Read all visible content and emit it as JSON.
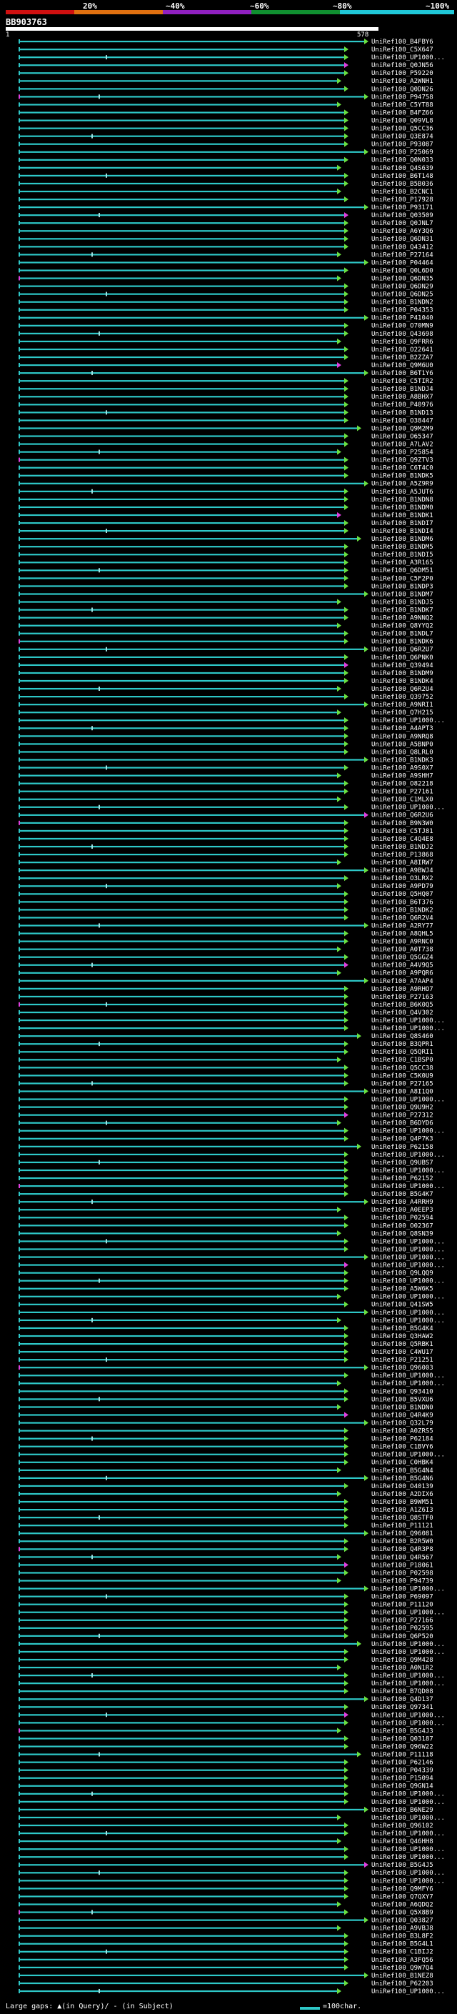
{
  "scale": {
    "labels": [
      "20%",
      "~40%",
      "~60%",
      "~80%",
      "~100%"
    ],
    "colors": [
      "#d01010",
      "#e07010",
      "#9020c0",
      "#109030",
      "#20c8d8"
    ]
  },
  "query": {
    "id": "BB903763",
    "start": "1",
    "end": "578"
  },
  "legend": {
    "text": "Large gaps: ▲(in Query)/ - (in Subject)",
    "scale_text": "=100char."
  },
  "colors": {
    "hit": "#2ec8c8",
    "arrow": "#6ae040",
    "magenta": "#e040e0",
    "gap": "#a0e0e0"
  },
  "hits": [
    "UniRef100_B4FBY6",
    "UniRef100_C5X647",
    "UniRef100_UP1000...",
    "UniRef100_Q0JN56",
    "UniRef100_P59220",
    "UniRef100_A2WNH1",
    "UniRef100_Q0DN26",
    "UniRef100_P94758",
    "UniRef100_C5YT88",
    "UniRef100_B4FZ66",
    "UniRef100_Q09VL8",
    "UniRef100_Q5CC36",
    "UniRef100_Q3E874",
    "UniRef100_P93087",
    "UniRef100_P25069",
    "UniRef100_Q0N033",
    "UniRef100_Q4S639",
    "UniRef100_B6T148",
    "UniRef100_B5B036",
    "UniRef100_B2CNC1",
    "UniRef100_P17928",
    "UniRef100_P93171",
    "UniRef100_Q03509",
    "UniRef100_Q0JNL7",
    "UniRef100_A6Y3Q6",
    "UniRef100_Q6DN31",
    "UniRef100_Q43412",
    "UniRef100_P27164",
    "UniRef100_P04464",
    "UniRef100_Q0L6D0",
    "UniRef100_Q6DN35",
    "UniRef100_Q6DN29",
    "UniRef100_Q6DN25",
    "UniRef100_B1NDN2",
    "UniRef100_P04353",
    "UniRef100_P41040",
    "UniRef100_O70MN9",
    "UniRef100_Q43698",
    "UniRef100_Q9FRR6",
    "UniRef100_O22641",
    "UniRef100_B2ZZA7",
    "UniRef100_Q9M6U0",
    "UniRef100_B6T1Y6",
    "UniRef100_C5TIR2",
    "UniRef100_B1NDJ4",
    "UniRef100_A8BHX7",
    "UniRef100_P40976",
    "UniRef100_B1ND13",
    "UniRef100_O38447",
    "UniRef100_Q9M2M9",
    "UniRef100_O65347",
    "UniRef100_A7LAV2",
    "UniRef100_P25854",
    "UniRef100_Q9ZTV3",
    "UniRef100_C6T4C0",
    "UniRef100_B1NDK5",
    "UniRef100_A5Z9R9",
    "UniRef100_A5JUT6",
    "UniRef100_B1NDN8",
    "UniRef100_B1NDM0",
    "UniRef100_B1NDK1",
    "UniRef100_B1NDI7",
    "UniRef100_B1NDI4",
    "UniRef100_B1NDM6",
    "UniRef100_B1NDM5",
    "UniRef100_B1NDI5",
    "UniRef100_A3R165",
    "UniRef100_Q6DM51",
    "UniRef100_C5F2P0",
    "UniRef100_B1NDP3",
    "UniRef100_B1NDM7",
    "UniRef100_B1NDJ5",
    "UniRef100_B1NDK7",
    "UniRef100_A9NNQ2",
    "UniRef100_Q8YYQ2",
    "UniRef100_B1NDL7",
    "UniRef100_B1NDK6",
    "UniRef100_Q6R2U7",
    "UniRef100_Q6PNK0",
    "UniRef100_Q39494",
    "UniRef100_B1NDM9",
    "UniRef100_B1NDK4",
    "UniRef100_Q6R2U4",
    "UniRef100_Q39752",
    "UniRef100_A9NRI1",
    "UniRef100_Q7H215",
    "UniRef100_UP1000...",
    "UniRef100_A4APT3",
    "UniRef100_A9NRQ8",
    "UniRef100_A5BNP0",
    "UniRef100_Q8LRL0",
    "UniRef100_B1NDK3",
    "UniRef100_A9S0X7",
    "UniRef100_A9SHH7",
    "UniRef100_O82218",
    "UniRef100_P27161",
    "UniRef100_C1MLX0",
    "UniRef100_UP1000...",
    "UniRef100_Q6R2U6",
    "UniRef100_B9N3W0",
    "UniRef100_C5TJ81",
    "UniRef100_C4Q4E8",
    "UniRef100_B1NDJ2",
    "UniRef100_P13868",
    "UniRef100_A8IRW7",
    "UniRef100_A9BWJ4",
    "UniRef100_O3LRX2",
    "UniRef100_A9PD79",
    "UniRef100_Q5HQ07",
    "UniRef100_B6T376",
    "UniRef100_B1NDK2",
    "UniRef100_Q6R2V4",
    "UniRef100_A2RY77",
    "UniRef100_A8QHL5",
    "UniRef100_A9RNC0",
    "UniRef100_A0T738",
    "UniRef100_Q5GGZ4",
    "UniRef100_A4V9Q5",
    "UniRef100_A9PQR6",
    "UniRef100_A7AAP4",
    "UniRef100_A9RHO7",
    "UniRef100_P27163",
    "UniRef100_B6K0Q5",
    "UniRef100_Q4V302",
    "UniRef100_UP1000...",
    "UniRef100_UP1000...",
    "UniRef100_Q8S460",
    "UniRef100_B3QPR1",
    "UniRef100_Q5QRI1",
    "UniRef100_C1BSP0",
    "UniRef100_Q5CC38",
    "UniRef100_C5K0U9",
    "UniRef100_P27165",
    "UniRef100_A8I1Q0",
    "UniRef100_UP1000...",
    "UniRef100_Q9U9H2",
    "UniRef100_P27312",
    "UniRef100_B6DYD6",
    "UniRef100_UP1000...",
    "UniRef100_Q4P7K3",
    "UniRef100_P62158",
    "UniRef100_UP1000...",
    "UniRef100_Q9UBS7",
    "UniRef100_UP1000...",
    "UniRef100_P62152",
    "UniRef100_UP1000...",
    "UniRef100_B5G4K7",
    "UniRef100_A4RRH9",
    "UniRef100_A0EEP3",
    "UniRef100_P02594",
    "UniRef100_O02367",
    "UniRef100_Q8SN39",
    "UniRef100_UP1000...",
    "UniRef100_UP1000...",
    "UniRef100_UP1000...",
    "UniRef100_UP1000...",
    "UniRef100_Q9LQQ9",
    "UniRef100_UP1000...",
    "UniRef100_A5W6K5",
    "UniRef100_UP1000...",
    "UniRef100_Q41SW5",
    "UniRef100_UP1000...",
    "UniRef100_UP1000...",
    "UniRef100_B5G4K4",
    "UniRef100_Q3HAW2",
    "UniRef100_Q5RBK1",
    "UniRef100_C4WU17",
    "UniRef100_P21251",
    "UniRef100_Q96003",
    "UniRef100_UP1000...",
    "UniRef100_UP1000...",
    "UniRef100_Q93410",
    "UniRef100_B5VXU6",
    "UniRef100_B1NDN0",
    "UniRef100_Q4R4K9",
    "UniRef100_Q32L79",
    "UniRef100_A0ZRS5",
    "UniRef100_P62184",
    "UniRef100_C1BVY6",
    "UniRef100_UP1000...",
    "UniRef100_C0HBK4",
    "UniRef100_B5G4N4",
    "UniRef100_B5G4N6",
    "UniRef100_O40139",
    "UniRef100_A2DIX6",
    "UniRef100_B9WM51",
    "UniRef100_A1Z6I3",
    "UniRef100_Q8STF0",
    "UniRef100_P11121",
    "UniRef100_Q96081",
    "UniRef100_B2R5W0",
    "UniRef100_Q4R3P8",
    "UniRef100_Q4R567",
    "UniRef100_P18061",
    "UniRef100_P02598",
    "UniRef100_P94739",
    "UniRef100_UP1000...",
    "UniRef100_P69097",
    "UniRef100_P11120",
    "UniRef100_UP1000...",
    "UniRef100_P27166",
    "UniRef100_P02595",
    "UniRef100_Q6P520",
    "UniRef100_UP1000...",
    "UniRef100_UP1000...",
    "UniRef100_Q9M428",
    "UniRef100_A0N1R2",
    "UniRef100_UP1000...",
    "UniRef100_UP1000...",
    "UniRef100_B7QD08",
    "UniRef100_Q4D137",
    "UniRef100_Q97341",
    "UniRef100_UP1000...",
    "UniRef100_UP1000...",
    "UniRef100_B5G4J3",
    "UniRef100_Q03187",
    "UniRef100_Q96W22",
    "UniRef100_P11118",
    "UniRef100_P62146",
    "UniRef100_P04339",
    "UniRef100_P15094",
    "UniRef100_Q9GN14",
    "UniRef100_UP1000...",
    "UniRef100_UP1000...",
    "UniRef100_B6NE29",
    "UniRef100_UP1000...",
    "UniRef100_Q96102",
    "UniRef100_UP1000...",
    "UniRef100_Q46HH8",
    "UniRef100_UP1000...",
    "UniRef100_UP1000...",
    "UniRef100_B5G4J5",
    "UniRef100_UP1000...",
    "UniRef100_UP1000...",
    "UniRef100_Q9MFY6",
    "UniRef100_Q7QXY7",
    "UniRef100_A6QDQ2",
    "UniRef100_Q5X8B9",
    "UniRef100_Q03827",
    "UniRef100_A9VBJ8",
    "UniRef100_B3L8F2",
    "UniRef100_B5G4L1",
    "UniRef100_C1BIJ2",
    "UniRef100_A3FQ56",
    "UniRef100_Q9W7Q4",
    "UniRef100_B1NEZ8",
    "UniRef100_P62203",
    "UniRef100_UP1000..."
  ]
}
